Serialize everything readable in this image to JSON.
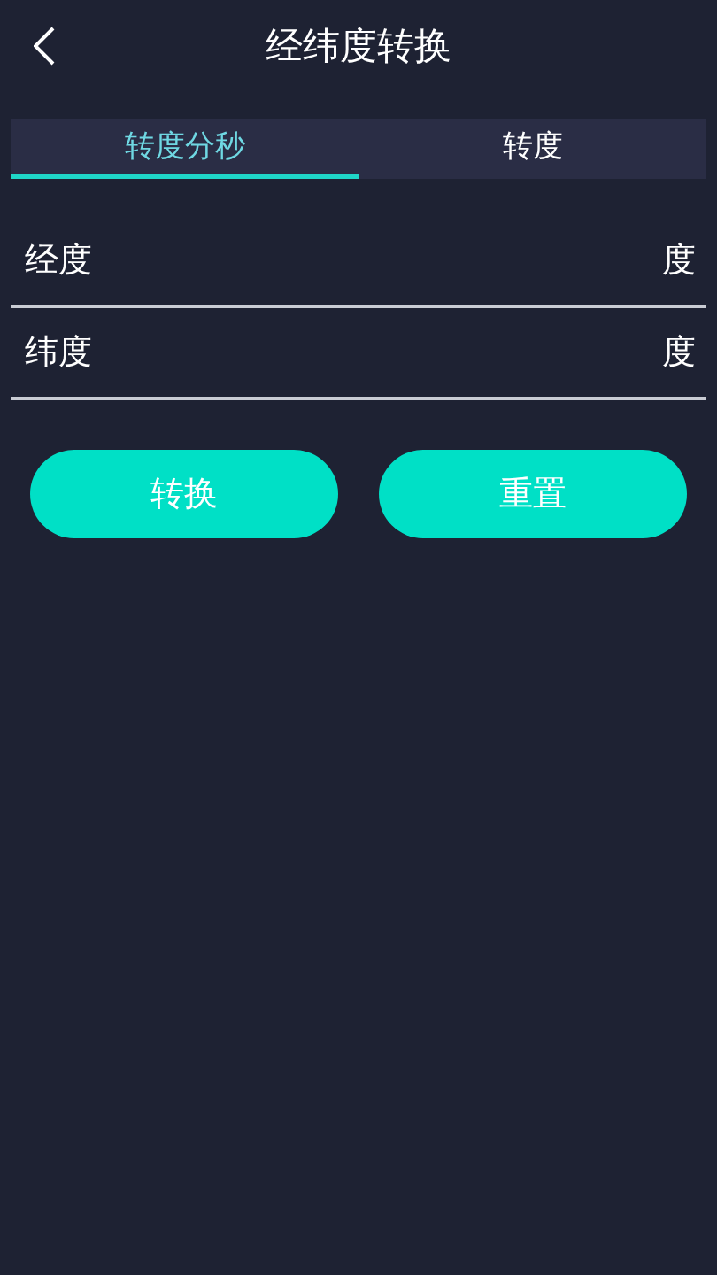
{
  "header": {
    "title": "经纬度转换"
  },
  "tabs": [
    {
      "label": "转度分秒",
      "selected": true
    },
    {
      "label": "转度",
      "selected": false
    }
  ],
  "fields": [
    {
      "label": "经度",
      "unit": "度"
    },
    {
      "label": "纬度",
      "unit": "度"
    }
  ],
  "buttons": [
    "转换",
    "重置"
  ]
}
